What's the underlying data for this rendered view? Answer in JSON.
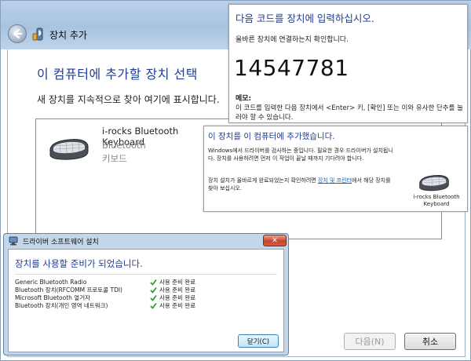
{
  "wizard": {
    "title": "장치 추가",
    "heading": "이 컴퓨터에 추가할 장치 선택",
    "subtext": "새 장치를 지속적으로 찾아 여기에 표시합니다.",
    "device": {
      "name": "i-rocks Bluetooth Keyboard",
      "connection": "Bluetooth",
      "kind": "키보드",
      "icon": "keyboard-icon"
    },
    "buttons": {
      "next": "다음(N)",
      "cancel": "취소"
    }
  },
  "pairing_popup": {
    "title": "다음 코드를 장치에 입력하십시오.",
    "subtitle": "올바른 장치에 연결하는지 확인합니다.",
    "code": "14547781",
    "memo_label": "메모:",
    "memo_text": "이 코드를 입력한 다음 장치에서 <Enter> 키, [확인] 또는 이와 유사한 단추를 눌러야 할 수 있습니다."
  },
  "notification": {
    "title": "이 장치를 이 컴퓨터에 추가했습니다.",
    "body1": "Windows에서 드라이버를 검사하는 중입니다. 필요한 경우 드라이버가 설치됩니다. 장치를 사용하려면 먼저 이 작업이 끝날 때까지 기다려야 합니다.",
    "body2_before": "장치 설치가 올바르게 완료되었는지 확인하려면 ",
    "body2_link": "장치 및 프린터",
    "body2_after": "에서 해당 장치를 찾아 보십시오.",
    "device_caption": "i-rocks Bluetooth Keyboard"
  },
  "driver_dialog": {
    "title": "드라이버 소프트웨어 설치",
    "heading": "장치를 사용할 준비가 되었습니다.",
    "rows": [
      {
        "name": "Generic Bluetooth Radio",
        "status": "사용 준비 완료"
      },
      {
        "name": "Bluetooth 장치(RFCOMM 프로토콜 TDI)",
        "status": "사용 준비 완료"
      },
      {
        "name": "Microsoft Bluetooth 열거자",
        "status": "사용 준비 완료"
      },
      {
        "name": "Bluetooth 장치(개인 영역 네트워크)",
        "status": "사용 준비 완료"
      }
    ],
    "close_label": "닫기(C)",
    "status_color": "#2f9e2f"
  },
  "colors": {
    "accent": "#1e3c96",
    "frame": "#b9d1ea"
  }
}
